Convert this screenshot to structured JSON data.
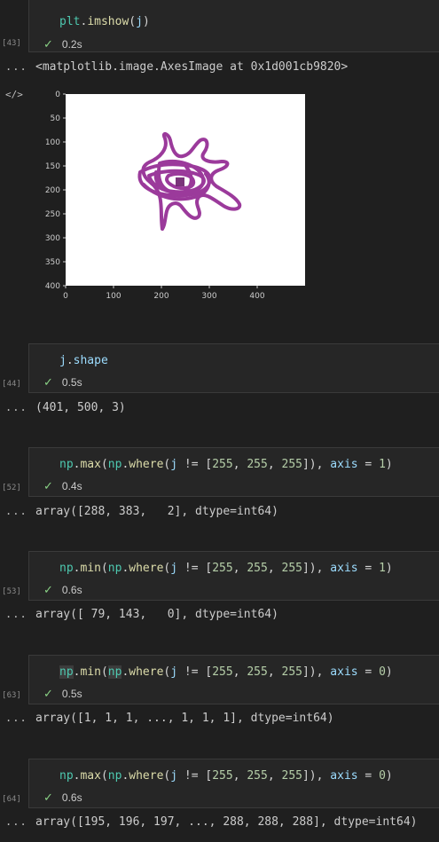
{
  "cells": [
    {
      "exec": "[43]",
      "code": "plt.imshow(j)",
      "status_time": "0.2s",
      "output": "<matplotlib.image.AxesImage at 0x1d001cb9820>"
    },
    {
      "exec": "[44]",
      "code": "j.shape",
      "status_time": "0.5s",
      "output": "(401, 500, 3)"
    },
    {
      "exec": "[52]",
      "code": "np.max(np.where(j != [255, 255, 255]), axis = 1)",
      "status_time": "0.4s",
      "output": "array([288, 383,   2], dtype=int64)"
    },
    {
      "exec": "[53]",
      "code": "np.min(np.where(j != [255, 255, 255]), axis = 1)",
      "status_time": "0.6s",
      "output": "array([ 79, 143,   0], dtype=int64)"
    },
    {
      "exec": "[63]",
      "code": "np.min(np.where(j != [255, 255, 255]), axis = 0)",
      "status_time": "0.5s",
      "output": "array([1, 1, 1, ..., 1, 1, 1], dtype=int64)"
    },
    {
      "exec": "[64]",
      "code": "np.max(np.where(j != [255, 255, 255]), axis = 0)",
      "status_time": "0.6s",
      "output": "array([195, 196, 197, ..., 288, 288, 288], dtype=int64)"
    }
  ],
  "ellipsis": "...",
  "output_toggle_icon": "code-icon",
  "check_icon": "check-icon",
  "chart_data": {
    "type": "heatmap",
    "title": "",
    "xlabel": "",
    "ylabel": "",
    "xlim": [
      0,
      500
    ],
    "ylim": [
      400,
      0
    ],
    "x_ticks": [
      "0",
      "100",
      "200",
      "300",
      "400"
    ],
    "y_ticks": [
      "0",
      "50",
      "100",
      "150",
      "200",
      "250",
      "300",
      "350",
      "400"
    ],
    "image_description_color": "#9b3a9b"
  }
}
